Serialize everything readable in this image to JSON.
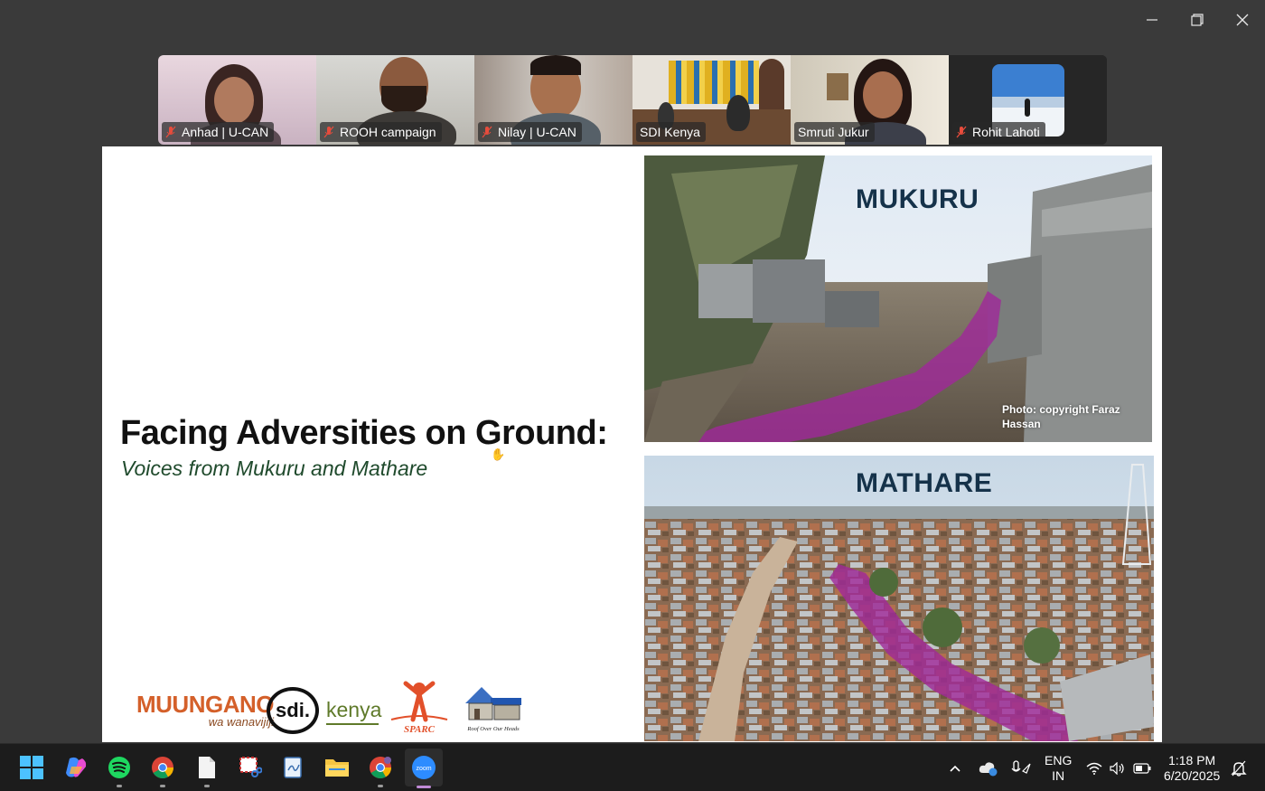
{
  "participants": [
    {
      "name": "Anhad | U-CAN",
      "muted": true
    },
    {
      "name": "ROOH campaign",
      "muted": true
    },
    {
      "name": "Nilay | U-CAN",
      "muted": true
    },
    {
      "name": "SDI Kenya",
      "muted": false,
      "active": true
    },
    {
      "name": "Smruti Jukur",
      "muted": false
    },
    {
      "name": "Rohit Lahoti",
      "muted": true
    }
  ],
  "slide": {
    "title": "Facing Adversities on Ground:",
    "subtitle": "Voices from Mukuru and Mathare",
    "photo_top": {
      "label": "MUKURU",
      "credit": "Photo: copyright Faraz Hassan"
    },
    "photo_bottom": {
      "label": "MATHARE"
    },
    "logos": {
      "muungano_main": "MUUNGANO",
      "muungano_sub": "wa wanavijiji",
      "sdi": "sdi.",
      "kenya": "kenya",
      "sparc": "SPARC",
      "roof": "Roof Over Our Heads"
    }
  },
  "taskbar": {
    "language_line1": "ENG",
    "language_line2": "IN",
    "time": "1:18 PM",
    "date": "6/20/2025"
  },
  "colors": {
    "active_tile_border": "#2fd68a",
    "river_overlay": "#a0289a",
    "title_text": "#111111",
    "subtitle_text": "#1f4a2c",
    "photo_label": "#15324a"
  }
}
